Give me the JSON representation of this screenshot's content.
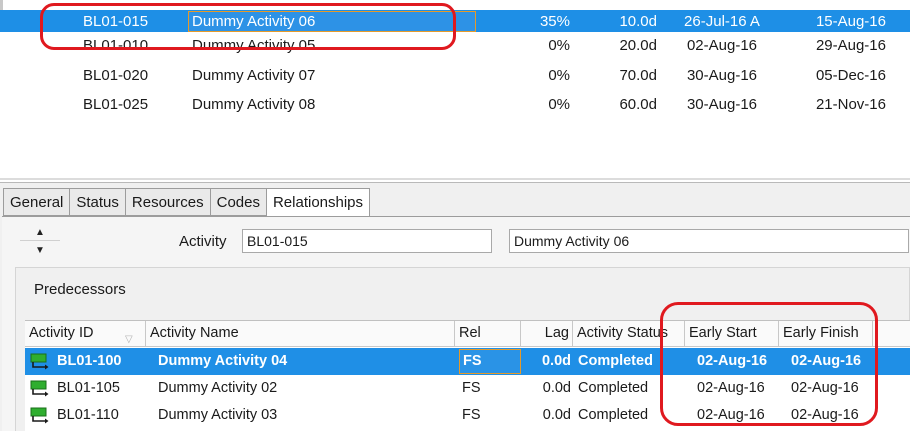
{
  "activities": [
    {
      "id": "BL01-015",
      "name": "Dummy Activity 06",
      "pct": "35%",
      "duration": "10.0d",
      "start": "26-Jul-16 A",
      "finish": "15-Aug-16",
      "selected": true
    },
    {
      "id": "BL01-010",
      "name": "Dummy Activity 05",
      "pct": "0%",
      "duration": "20.0d",
      "start": "02-Aug-16",
      "finish": "29-Aug-16"
    },
    {
      "id": "BL01-020",
      "name": "Dummy Activity 07",
      "pct": "0%",
      "duration": "70.0d",
      "start": "30-Aug-16",
      "finish": "05-Dec-16"
    },
    {
      "id": "BL01-025",
      "name": "Dummy Activity 08",
      "pct": "0%",
      "duration": "60.0d",
      "start": "30-Aug-16",
      "finish": "21-Nov-16"
    }
  ],
  "tabs": [
    "General",
    "Status",
    "Resources",
    "Codes",
    "Relationships"
  ],
  "active_tab": "Relationships",
  "detail": {
    "activity_label": "Activity",
    "activity_id": "BL01-015",
    "activity_name": "Dummy Activity 06"
  },
  "predecessors": {
    "title": "Predecessors",
    "columns": [
      "Activity ID",
      "Activity Name",
      "Rel",
      "Lag",
      "Activity Status",
      "Early Start",
      "Early Finish"
    ],
    "rows": [
      {
        "id": "BL01-100",
        "name": "Dummy Activity 04",
        "rel": "FS",
        "lag": "0.0d",
        "status": "Completed",
        "early_start": "02-Aug-16",
        "early_finish": "02-Aug-16",
        "selected": true
      },
      {
        "id": "BL01-105",
        "name": "Dummy Activity 02",
        "rel": "FS",
        "lag": "0.0d",
        "status": "Completed",
        "early_start": "02-Aug-16",
        "early_finish": "02-Aug-16"
      },
      {
        "id": "BL01-110",
        "name": "Dummy Activity 03",
        "rel": "FS",
        "lag": "0.0d",
        "status": "Completed",
        "early_start": "02-Aug-16",
        "early_finish": "02-Aug-16"
      }
    ]
  },
  "colors": {
    "selection": "#1e8fe6",
    "highlight_ring": "#e0191f",
    "edit_border": "#e59a2b"
  },
  "icons": {
    "row_icon": "relationship-link-icon",
    "spinner_up": "arrow-up-icon",
    "spinner_down": "arrow-down-icon"
  }
}
